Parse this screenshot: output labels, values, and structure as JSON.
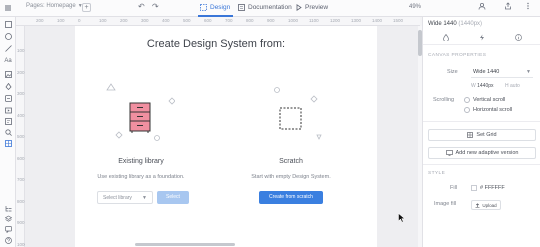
{
  "topbar": {
    "page_label": "Pages: Homepage",
    "add_page": "+",
    "tabs": [
      {
        "label": "Design",
        "icon": "design-icon"
      },
      {
        "label": "Documentation",
        "icon": "documentation-icon"
      },
      {
        "label": "Preview",
        "icon": "play-icon"
      }
    ],
    "zoom": "49%",
    "accent": "#3a76d8"
  },
  "ruler_h": [
    "200",
    "100",
    "0",
    "100",
    "200",
    "300",
    "400",
    "500",
    "600",
    "700",
    "800",
    "900",
    "1000",
    "1100",
    "1200",
    "1300",
    "1400",
    "1500"
  ],
  "ruler_v": [
    "100",
    "200",
    "300",
    "400",
    "500",
    "600",
    "700",
    "800",
    "900",
    "1000"
  ],
  "canvas": {
    "headline": "Create Design System from:",
    "existing": {
      "title": "Existing library",
      "desc": "Use existing library as a foundation.",
      "select_placeholder": "Select library",
      "select_button": "Select"
    },
    "scratch": {
      "title": "Scratch",
      "desc": "Start with empty Design System.",
      "create_button": "Create from scratch"
    }
  },
  "panel": {
    "title": "Wide 1440",
    "title_dim": "(1440px)",
    "section_canvas": "CANVAS PROPERTIES",
    "size_label": "Size",
    "size_value": "Wide 1440",
    "w_label": "W",
    "w_value": "1440px",
    "h_label": "H",
    "h_value": "auto",
    "scrolling_label": "Scrolling",
    "scroll_vertical": "Vertical scroll",
    "scroll_horizontal": "Horizontal scroll",
    "set_grid": "Set Grid",
    "add_adaptive": "Add new adaptive version",
    "section_style": "STYLE",
    "fill_label": "Fill",
    "fill_value": "# FFFFFF",
    "image_fill_label": "Image fill",
    "upload": "Upload"
  }
}
